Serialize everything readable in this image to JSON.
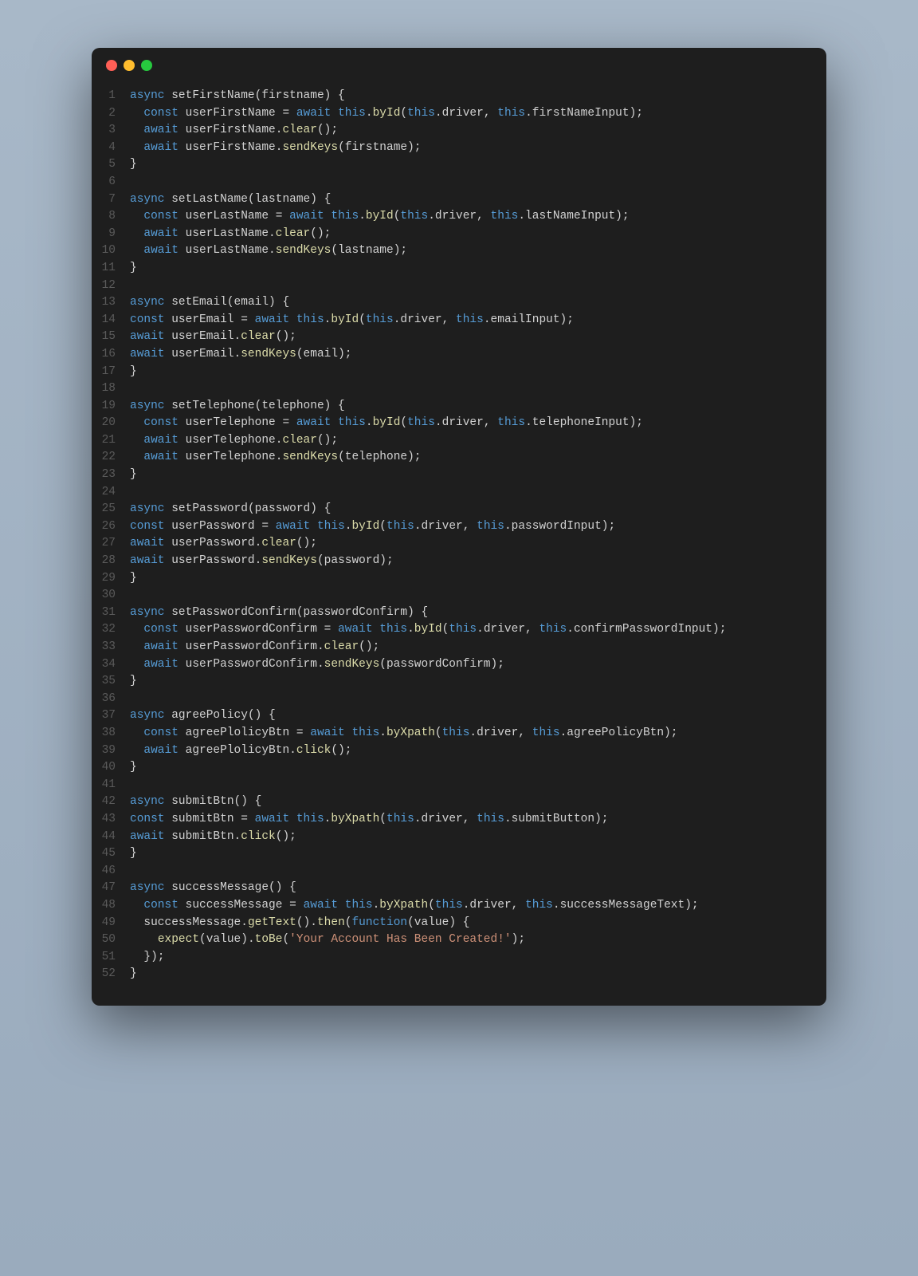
{
  "window": {
    "dots": [
      "red",
      "yellow",
      "green"
    ]
  },
  "code": {
    "lines": [
      {
        "n": 1,
        "t": [
          [
            "kw",
            "async"
          ],
          [
            "pn",
            " "
          ],
          [
            "fn",
            "setFirstName"
          ],
          [
            "pn",
            "(firstname) {"
          ]
        ]
      },
      {
        "n": 2,
        "t": [
          [
            "pn",
            "  "
          ],
          [
            "kw",
            "const"
          ],
          [
            "pn",
            " userFirstName = "
          ],
          [
            "kw",
            "await"
          ],
          [
            "pn",
            " "
          ],
          [
            "kw",
            "this"
          ],
          [
            "pn",
            "."
          ],
          [
            "call",
            "byId"
          ],
          [
            "pn",
            "("
          ],
          [
            "kw",
            "this"
          ],
          [
            "pn",
            ".driver, "
          ],
          [
            "kw",
            "this"
          ],
          [
            "pn",
            ".firstNameInput);"
          ]
        ]
      },
      {
        "n": 3,
        "t": [
          [
            "pn",
            "  "
          ],
          [
            "kw",
            "await"
          ],
          [
            "pn",
            " userFirstName."
          ],
          [
            "call",
            "clear"
          ],
          [
            "pn",
            "();"
          ]
        ]
      },
      {
        "n": 4,
        "t": [
          [
            "pn",
            "  "
          ],
          [
            "kw",
            "await"
          ],
          [
            "pn",
            " userFirstName."
          ],
          [
            "call",
            "sendKeys"
          ],
          [
            "pn",
            "(firstname);"
          ]
        ]
      },
      {
        "n": 5,
        "t": [
          [
            "pn",
            "}"
          ]
        ]
      },
      {
        "n": 6,
        "t": [
          [
            "pn",
            ""
          ]
        ]
      },
      {
        "n": 7,
        "t": [
          [
            "kw",
            "async"
          ],
          [
            "pn",
            " "
          ],
          [
            "fn",
            "setLastName"
          ],
          [
            "pn",
            "(lastname) {"
          ]
        ]
      },
      {
        "n": 8,
        "t": [
          [
            "pn",
            "  "
          ],
          [
            "kw",
            "const"
          ],
          [
            "pn",
            " userLastName = "
          ],
          [
            "kw",
            "await"
          ],
          [
            "pn",
            " "
          ],
          [
            "kw",
            "this"
          ],
          [
            "pn",
            "."
          ],
          [
            "call",
            "byId"
          ],
          [
            "pn",
            "("
          ],
          [
            "kw",
            "this"
          ],
          [
            "pn",
            ".driver, "
          ],
          [
            "kw",
            "this"
          ],
          [
            "pn",
            ".lastNameInput);"
          ]
        ]
      },
      {
        "n": 9,
        "t": [
          [
            "pn",
            "  "
          ],
          [
            "kw",
            "await"
          ],
          [
            "pn",
            " userLastName."
          ],
          [
            "call",
            "clear"
          ],
          [
            "pn",
            "();"
          ]
        ]
      },
      {
        "n": 10,
        "t": [
          [
            "pn",
            "  "
          ],
          [
            "kw",
            "await"
          ],
          [
            "pn",
            " userLastName."
          ],
          [
            "call",
            "sendKeys"
          ],
          [
            "pn",
            "(lastname);"
          ]
        ]
      },
      {
        "n": 11,
        "t": [
          [
            "pn",
            "}"
          ]
        ]
      },
      {
        "n": 12,
        "t": [
          [
            "pn",
            ""
          ]
        ]
      },
      {
        "n": 13,
        "t": [
          [
            "kw",
            "async"
          ],
          [
            "pn",
            " "
          ],
          [
            "fn",
            "setEmail"
          ],
          [
            "pn",
            "(email) {"
          ]
        ]
      },
      {
        "n": 14,
        "t": [
          [
            "kw",
            "const"
          ],
          [
            "pn",
            " userEmail = "
          ],
          [
            "kw",
            "await"
          ],
          [
            "pn",
            " "
          ],
          [
            "kw",
            "this"
          ],
          [
            "pn",
            "."
          ],
          [
            "call",
            "byId"
          ],
          [
            "pn",
            "("
          ],
          [
            "kw",
            "this"
          ],
          [
            "pn",
            ".driver, "
          ],
          [
            "kw",
            "this"
          ],
          [
            "pn",
            ".emailInput);"
          ]
        ]
      },
      {
        "n": 15,
        "t": [
          [
            "kw",
            "await"
          ],
          [
            "pn",
            " userEmail."
          ],
          [
            "call",
            "clear"
          ],
          [
            "pn",
            "();"
          ]
        ]
      },
      {
        "n": 16,
        "t": [
          [
            "kw",
            "await"
          ],
          [
            "pn",
            " userEmail."
          ],
          [
            "call",
            "sendKeys"
          ],
          [
            "pn",
            "(email);"
          ]
        ]
      },
      {
        "n": 17,
        "t": [
          [
            "pn",
            "}"
          ]
        ]
      },
      {
        "n": 18,
        "t": [
          [
            "pn",
            ""
          ]
        ]
      },
      {
        "n": 19,
        "t": [
          [
            "kw",
            "async"
          ],
          [
            "pn",
            " "
          ],
          [
            "fn",
            "setTelephone"
          ],
          [
            "pn",
            "(telephone) {"
          ]
        ]
      },
      {
        "n": 20,
        "t": [
          [
            "pn",
            "  "
          ],
          [
            "kw",
            "const"
          ],
          [
            "pn",
            " userTelephone = "
          ],
          [
            "kw",
            "await"
          ],
          [
            "pn",
            " "
          ],
          [
            "kw",
            "this"
          ],
          [
            "pn",
            "."
          ],
          [
            "call",
            "byId"
          ],
          [
            "pn",
            "("
          ],
          [
            "kw",
            "this"
          ],
          [
            "pn",
            ".driver, "
          ],
          [
            "kw",
            "this"
          ],
          [
            "pn",
            ".telephoneInput);"
          ]
        ]
      },
      {
        "n": 21,
        "t": [
          [
            "pn",
            "  "
          ],
          [
            "kw",
            "await"
          ],
          [
            "pn",
            " userTelephone."
          ],
          [
            "call",
            "clear"
          ],
          [
            "pn",
            "();"
          ]
        ]
      },
      {
        "n": 22,
        "t": [
          [
            "pn",
            "  "
          ],
          [
            "kw",
            "await"
          ],
          [
            "pn",
            " userTelephone."
          ],
          [
            "call",
            "sendKeys"
          ],
          [
            "pn",
            "(telephone);"
          ]
        ]
      },
      {
        "n": 23,
        "t": [
          [
            "pn",
            "}"
          ]
        ]
      },
      {
        "n": 24,
        "t": [
          [
            "pn",
            ""
          ]
        ]
      },
      {
        "n": 25,
        "t": [
          [
            "kw",
            "async"
          ],
          [
            "pn",
            " "
          ],
          [
            "fn",
            "setPassword"
          ],
          [
            "pn",
            "(password) {"
          ]
        ]
      },
      {
        "n": 26,
        "t": [
          [
            "kw",
            "const"
          ],
          [
            "pn",
            " userPassword = "
          ],
          [
            "kw",
            "await"
          ],
          [
            "pn",
            " "
          ],
          [
            "kw",
            "this"
          ],
          [
            "pn",
            "."
          ],
          [
            "call",
            "byId"
          ],
          [
            "pn",
            "("
          ],
          [
            "kw",
            "this"
          ],
          [
            "pn",
            ".driver, "
          ],
          [
            "kw",
            "this"
          ],
          [
            "pn",
            ".passwordInput);"
          ]
        ]
      },
      {
        "n": 27,
        "t": [
          [
            "kw",
            "await"
          ],
          [
            "pn",
            " userPassword."
          ],
          [
            "call",
            "clear"
          ],
          [
            "pn",
            "();"
          ]
        ]
      },
      {
        "n": 28,
        "t": [
          [
            "kw",
            "await"
          ],
          [
            "pn",
            " userPassword."
          ],
          [
            "call",
            "sendKeys"
          ],
          [
            "pn",
            "(password);"
          ]
        ]
      },
      {
        "n": 29,
        "t": [
          [
            "pn",
            "}"
          ]
        ]
      },
      {
        "n": 30,
        "t": [
          [
            "pn",
            ""
          ]
        ]
      },
      {
        "n": 31,
        "t": [
          [
            "kw",
            "async"
          ],
          [
            "pn",
            " "
          ],
          [
            "fn",
            "setPasswordConfirm"
          ],
          [
            "pn",
            "(passwordConfirm) {"
          ]
        ]
      },
      {
        "n": 32,
        "t": [
          [
            "pn",
            "  "
          ],
          [
            "kw",
            "const"
          ],
          [
            "pn",
            " userPasswordConfirm = "
          ],
          [
            "kw",
            "await"
          ],
          [
            "pn",
            " "
          ],
          [
            "kw",
            "this"
          ],
          [
            "pn",
            "."
          ],
          [
            "call",
            "byId"
          ],
          [
            "pn",
            "("
          ],
          [
            "kw",
            "this"
          ],
          [
            "pn",
            ".driver, "
          ],
          [
            "kw",
            "this"
          ],
          [
            "pn",
            ".confirmPasswordInput);"
          ]
        ]
      },
      {
        "n": 33,
        "t": [
          [
            "pn",
            "  "
          ],
          [
            "kw",
            "await"
          ],
          [
            "pn",
            " userPasswordConfirm."
          ],
          [
            "call",
            "clear"
          ],
          [
            "pn",
            "();"
          ]
        ]
      },
      {
        "n": 34,
        "t": [
          [
            "pn",
            "  "
          ],
          [
            "kw",
            "await"
          ],
          [
            "pn",
            " userPasswordConfirm."
          ],
          [
            "call",
            "sendKeys"
          ],
          [
            "pn",
            "(passwordConfirm);"
          ]
        ]
      },
      {
        "n": 35,
        "t": [
          [
            "pn",
            "}"
          ]
        ]
      },
      {
        "n": 36,
        "t": [
          [
            "pn",
            ""
          ]
        ]
      },
      {
        "n": 37,
        "t": [
          [
            "kw",
            "async"
          ],
          [
            "pn",
            " "
          ],
          [
            "fn",
            "agreePolicy"
          ],
          [
            "pn",
            "() {"
          ]
        ]
      },
      {
        "n": 38,
        "t": [
          [
            "pn",
            "  "
          ],
          [
            "kw",
            "const"
          ],
          [
            "pn",
            " agreePlolicyBtn = "
          ],
          [
            "kw",
            "await"
          ],
          [
            "pn",
            " "
          ],
          [
            "kw",
            "this"
          ],
          [
            "pn",
            "."
          ],
          [
            "call",
            "byXpath"
          ],
          [
            "pn",
            "("
          ],
          [
            "kw",
            "this"
          ],
          [
            "pn",
            ".driver, "
          ],
          [
            "kw",
            "this"
          ],
          [
            "pn",
            ".agreePolicyBtn);"
          ]
        ]
      },
      {
        "n": 39,
        "t": [
          [
            "pn",
            "  "
          ],
          [
            "kw",
            "await"
          ],
          [
            "pn",
            " agreePlolicyBtn."
          ],
          [
            "call",
            "click"
          ],
          [
            "pn",
            "();"
          ]
        ]
      },
      {
        "n": 40,
        "t": [
          [
            "pn",
            "}"
          ]
        ]
      },
      {
        "n": 41,
        "t": [
          [
            "pn",
            ""
          ]
        ]
      },
      {
        "n": 42,
        "t": [
          [
            "kw",
            "async"
          ],
          [
            "pn",
            " "
          ],
          [
            "fn",
            "submitBtn"
          ],
          [
            "pn",
            "() {"
          ]
        ]
      },
      {
        "n": 43,
        "t": [
          [
            "kw",
            "const"
          ],
          [
            "pn",
            " submitBtn = "
          ],
          [
            "kw",
            "await"
          ],
          [
            "pn",
            " "
          ],
          [
            "kw",
            "this"
          ],
          [
            "pn",
            "."
          ],
          [
            "call",
            "byXpath"
          ],
          [
            "pn",
            "("
          ],
          [
            "kw",
            "this"
          ],
          [
            "pn",
            ".driver, "
          ],
          [
            "kw",
            "this"
          ],
          [
            "pn",
            ".submitButton);"
          ]
        ]
      },
      {
        "n": 44,
        "t": [
          [
            "kw",
            "await"
          ],
          [
            "pn",
            " submitBtn."
          ],
          [
            "call",
            "click"
          ],
          [
            "pn",
            "();"
          ]
        ]
      },
      {
        "n": 45,
        "t": [
          [
            "pn",
            "}"
          ]
        ]
      },
      {
        "n": 46,
        "t": [
          [
            "pn",
            ""
          ]
        ]
      },
      {
        "n": 47,
        "t": [
          [
            "kw",
            "async"
          ],
          [
            "pn",
            " "
          ],
          [
            "fn",
            "successMessage"
          ],
          [
            "pn",
            "() {"
          ]
        ]
      },
      {
        "n": 48,
        "t": [
          [
            "pn",
            "  "
          ],
          [
            "kw",
            "const"
          ],
          [
            "pn",
            " successMessage = "
          ],
          [
            "kw",
            "await"
          ],
          [
            "pn",
            " "
          ],
          [
            "kw",
            "this"
          ],
          [
            "pn",
            "."
          ],
          [
            "call",
            "byXpath"
          ],
          [
            "pn",
            "("
          ],
          [
            "kw",
            "this"
          ],
          [
            "pn",
            ".driver, "
          ],
          [
            "kw",
            "this"
          ],
          [
            "pn",
            ".successMessageText);"
          ]
        ]
      },
      {
        "n": 49,
        "t": [
          [
            "pn",
            "  successMessage."
          ],
          [
            "call",
            "getText"
          ],
          [
            "pn",
            "()."
          ],
          [
            "call",
            "then"
          ],
          [
            "pn",
            "("
          ],
          [
            "kw",
            "function"
          ],
          [
            "pn",
            "(value) {"
          ]
        ]
      },
      {
        "n": 50,
        "t": [
          [
            "pn",
            "    "
          ],
          [
            "call",
            "expect"
          ],
          [
            "pn",
            "(value)."
          ],
          [
            "call",
            "toBe"
          ],
          [
            "pn",
            "("
          ],
          [
            "str",
            "'Your Account Has Been Created!'"
          ],
          [
            "pn",
            ");"
          ]
        ]
      },
      {
        "n": 51,
        "t": [
          [
            "pn",
            "  });"
          ]
        ]
      },
      {
        "n": 52,
        "t": [
          [
            "pn",
            "}"
          ]
        ]
      }
    ]
  }
}
